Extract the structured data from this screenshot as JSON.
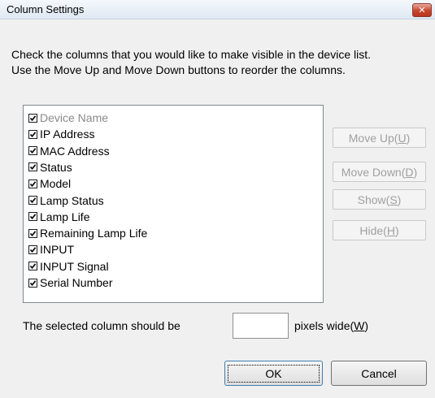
{
  "window": {
    "title": "Column Settings",
    "close_glyph": "✕"
  },
  "description": {
    "line1": "Check the columns that you would like to make visible in the device list.",
    "line2": "Use the Move Up and Move Down buttons to reorder the columns."
  },
  "columns": [
    {
      "label": "Device Name",
      "checked": true,
      "enabled": false
    },
    {
      "label": "IP Address",
      "checked": true,
      "enabled": true
    },
    {
      "label": "MAC Address",
      "checked": true,
      "enabled": true
    },
    {
      "label": "Status",
      "checked": true,
      "enabled": true
    },
    {
      "label": "Model",
      "checked": true,
      "enabled": true
    },
    {
      "label": "Lamp Status",
      "checked": true,
      "enabled": true
    },
    {
      "label": "Lamp Life",
      "checked": true,
      "enabled": true
    },
    {
      "label": "Remaining Lamp Life",
      "checked": true,
      "enabled": true
    },
    {
      "label": "INPUT",
      "checked": true,
      "enabled": true
    },
    {
      "label": "INPUT Signal",
      "checked": true,
      "enabled": true
    },
    {
      "label": "Serial Number",
      "checked": true,
      "enabled": true
    }
  ],
  "side_buttons": {
    "move_up": {
      "label": "Move Up(",
      "key": "U",
      "end": ")"
    },
    "move_down": {
      "label": "Move Down(",
      "key": "D",
      "end": ")"
    },
    "show": {
      "label": "Show(",
      "key": "S",
      "end": ")"
    },
    "hide": {
      "label": "Hide(",
      "key": "H",
      "end": ")"
    }
  },
  "width": {
    "label": "The selected column should be",
    "value": "",
    "suffix": "pixels wide(",
    "suffix_key": "W",
    "suffix_end": ")"
  },
  "footer": {
    "ok_label": "OK",
    "cancel_label": "Cancel"
  }
}
